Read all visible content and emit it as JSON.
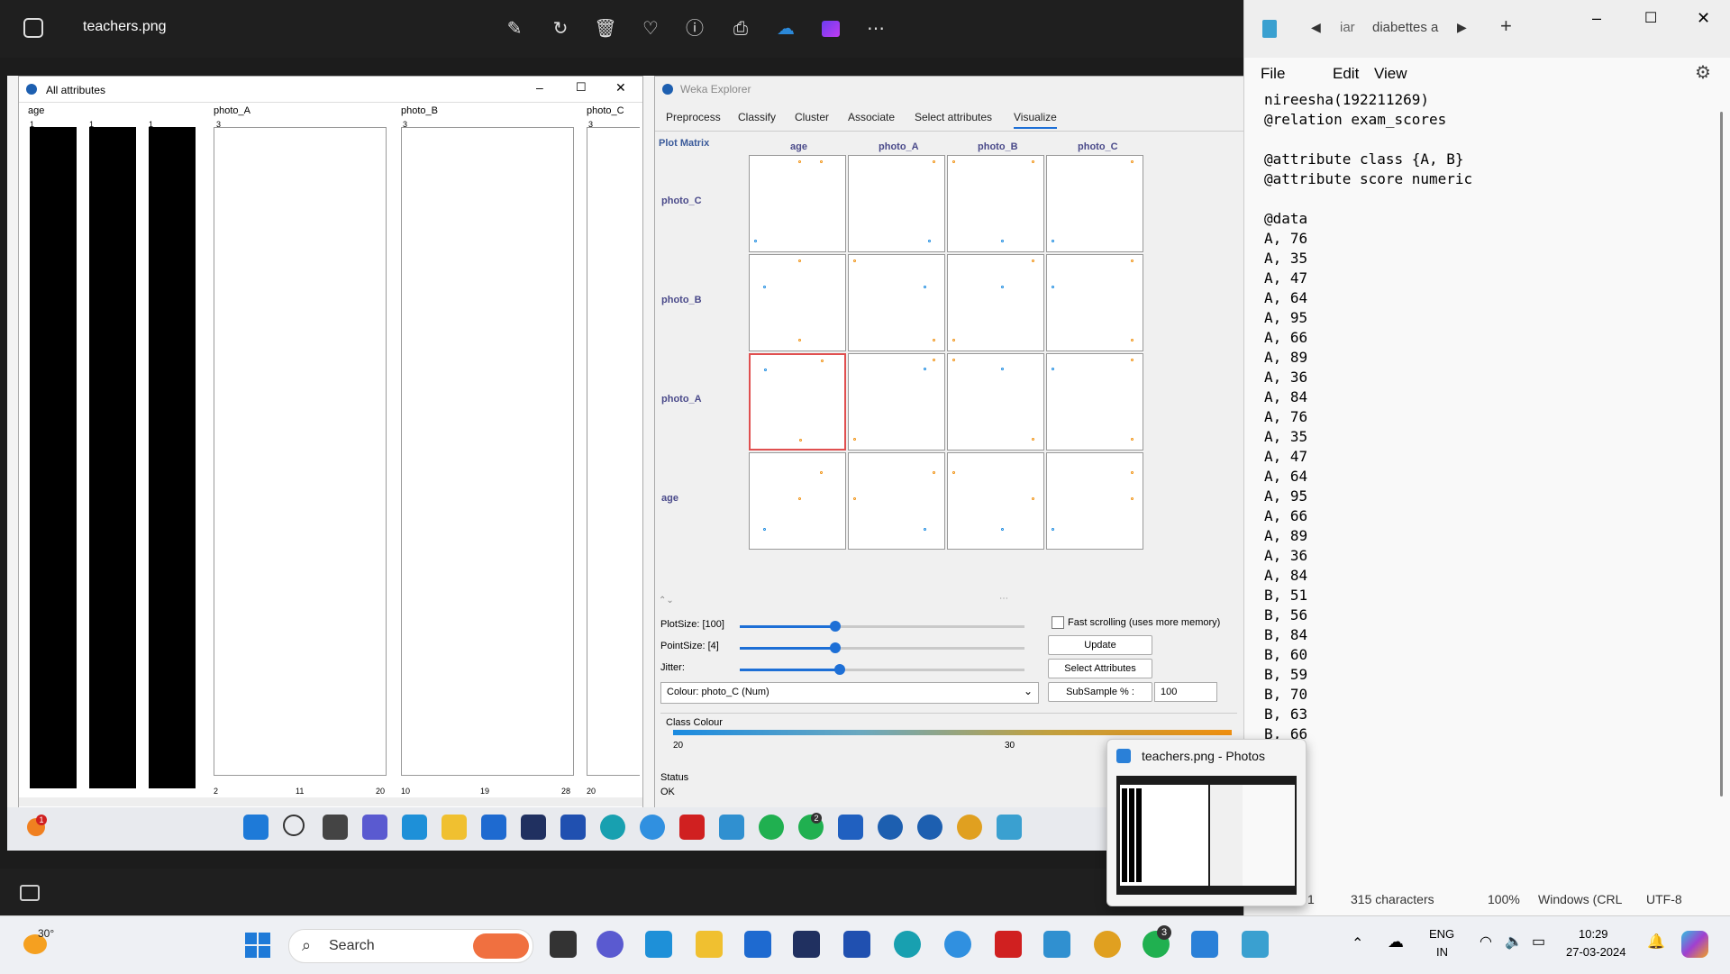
{
  "photos": {
    "title": "teachers.png",
    "tools": [
      "edit-icon",
      "rotate-icon",
      "delete-icon",
      "favorite-icon",
      "info-icon",
      "print-icon",
      "onedrive-icon",
      "clipchamp-icon",
      "more-icon"
    ]
  },
  "allattributes": {
    "title": "All attributes",
    "columns": [
      "age",
      "photo_A",
      "photo_B",
      "photo_C"
    ],
    "age_counts": [
      "1",
      "1",
      "1"
    ],
    "photo_A_count": "3",
    "photo_B_count": "3",
    "photo_C_count": "3",
    "photo_A_axis": [
      "2",
      "11",
      "20"
    ],
    "photo_B_axis": [
      "10",
      "19",
      "28"
    ],
    "photo_C_axis": [
      "20"
    ]
  },
  "weka": {
    "title": "Weka Explorer",
    "tabs": [
      "Preprocess",
      "Classify",
      "Cluster",
      "Associate",
      "Select attributes",
      "Visualize"
    ],
    "plot_matrix_label": "Plot Matrix",
    "col_labels": [
      "age",
      "photo_A",
      "photo_B",
      "photo_C"
    ],
    "row_labels": [
      "photo_C",
      "photo_B",
      "photo_A",
      "age"
    ],
    "plotsize_label": "PlotSize: [100]",
    "pointsize_label": "PointSize: [4]",
    "jitter_label": "Jitter:",
    "plotsize_value": 100,
    "pointsize_value": 4,
    "fast_scrolling_label": "Fast scrolling (uses more memory)",
    "update_button": "Update",
    "select_attributes_button": "Select Attributes",
    "colour_select": "Colour: photo_C  (Num)",
    "subsample_label": "SubSample % :",
    "subsample_value": "100",
    "class_colour_label": "Class Colour",
    "class_colour_ticks": [
      "20",
      "30"
    ],
    "status_label": "Status",
    "status_value": "OK"
  },
  "notepad": {
    "tab_prev": "iar",
    "tab_title": "diabettes a",
    "menu": [
      "File",
      "Edit",
      "View"
    ],
    "content": "nireesha(192211269)\n@relation exam_scores\n\n@attribute class {A, B}\n@attribute score numeric\n\n@data\nA, 76\nA, 35\nA, 47\nA, 64\nA, 95\nA, 66\nA, 89\nA, 36\nA, 84\nA, 76\nA, 35\nA, 47\nA, 64\nA, 95\nA, 66\nA, 89\nA, 36\nA, 84\nB, 51\nB, 56\nB, 84\nB, 60\nB, 59\nB, 70\nB, 63\nB, 66",
    "status_line": "1",
    "status_chars": "315 characters",
    "status_zoom": "100%",
    "status_eol": "Windows (CRL",
    "status_enc": "UTF-8"
  },
  "thumbnail": {
    "title": "teachers.png - Photos"
  },
  "taskbar": {
    "weather_temp": "30°",
    "search_placeholder": "Search",
    "lang_top": "ENG",
    "lang_bottom": "IN",
    "time": "10:29",
    "date": "27-03-2024",
    "whatsapp_badge": "3",
    "inner_whatsapp_badge": "2",
    "inner_notification_badge": "1"
  }
}
